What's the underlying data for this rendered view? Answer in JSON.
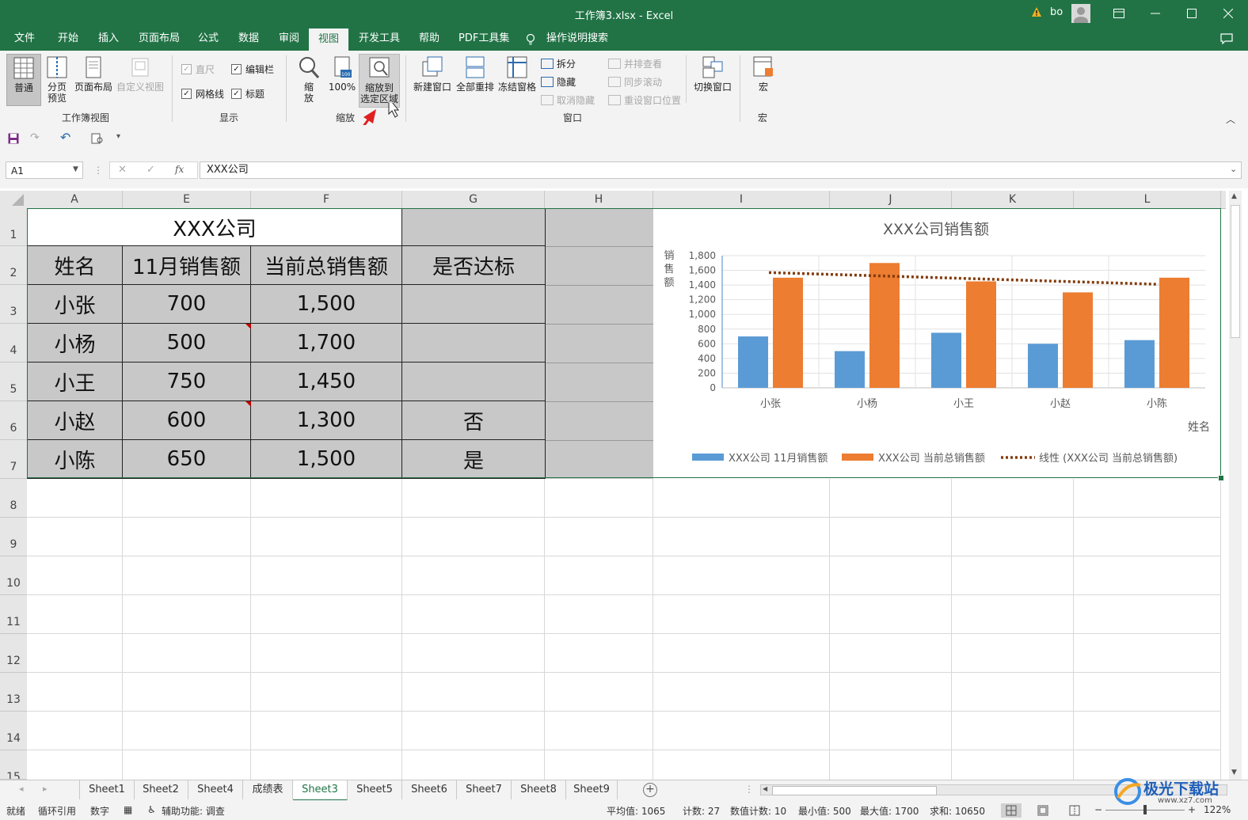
{
  "window": {
    "title": "工作簿3.xlsx  -  Excel",
    "user": "bo",
    "warning_icon": "warning-icon"
  },
  "menu": [
    "文件",
    "开始",
    "插入",
    "页面布局",
    "公式",
    "数据",
    "审阅",
    "视图",
    "开发工具",
    "帮助",
    "PDF工具集",
    "操作说明搜索"
  ],
  "menu_active": "视图",
  "ribbon": {
    "workbook_views": {
      "label": "工作簿视图",
      "normal": "普通",
      "page_break": "分页\n预览",
      "page_layout": "页面布局",
      "custom": "自定义视图"
    },
    "show": {
      "label": "显示",
      "ruler": "直尺",
      "formula_bar": "编辑栏",
      "gridlines": "网格线",
      "headings": "标题"
    },
    "zoom": {
      "label": "缩放",
      "zoom": "缩\n放",
      "zoom100": "100%",
      "zoom_selection": "缩放到\n选定区域"
    },
    "window": {
      "label": "窗口",
      "new_window": "新建窗口",
      "arrange_all": "全部重排",
      "freeze_panes": "冻结窗格",
      "split": "拆分",
      "hide": "隐藏",
      "unhide": "取消隐藏",
      "side_by_side": "并排查看",
      "sync_scroll": "同步滚动",
      "reset_position": "重设窗口位置",
      "switch_windows": "切换窗口"
    },
    "macros": {
      "label": "宏",
      "macros": "宏"
    }
  },
  "formula_bar": {
    "name_box": "A1",
    "content": "XXX公司",
    "fx": "fx"
  },
  "columns": [
    "A",
    "E",
    "F",
    "G",
    "H",
    "I",
    "J",
    "K",
    "L"
  ],
  "rows": [
    "1",
    "2",
    "3",
    "4",
    "5",
    "6",
    "7",
    "8",
    "9",
    "10",
    "11",
    "12",
    "13",
    "14",
    "15"
  ],
  "table": {
    "title": "XXX公司",
    "headers": [
      "姓名",
      "11月销售额",
      "当前总销售额",
      "是否达标"
    ],
    "rows": [
      [
        "小张",
        "700",
        "1,500",
        ""
      ],
      [
        "小杨",
        "500",
        "1,700",
        ""
      ],
      [
        "小王",
        "750",
        "1,450",
        ""
      ],
      [
        "小赵",
        "600",
        "1,300",
        "否"
      ],
      [
        "小陈",
        "650",
        "1,500",
        "是"
      ]
    ]
  },
  "chart_data": {
    "type": "bar",
    "title": "XXX公司销售额",
    "xlabel": "姓名",
    "ylabel": "销售额",
    "categories": [
      "小张",
      "小杨",
      "小王",
      "小赵",
      "小陈"
    ],
    "ylim": [
      0,
      1800
    ],
    "yticks": [
      "0",
      "200",
      "400",
      "600",
      "800",
      "1,000",
      "1,200",
      "1,400",
      "1,600",
      "1,800"
    ],
    "series": [
      {
        "name": "XXX公司 11月销售额",
        "values": [
          700,
          500,
          750,
          600,
          650
        ],
        "color": "#5b9bd5"
      },
      {
        "name": "XXX公司 当前总销售额",
        "values": [
          1500,
          1700,
          1450,
          1300,
          1500
        ],
        "color": "#ed7d31"
      }
    ],
    "trendline": {
      "name": "线性 (XXX公司 当前总销售额)",
      "color": "#843c0c",
      "values": [
        1570,
        1530,
        1490,
        1450,
        1410
      ]
    },
    "legend": "bottom",
    "grid": true
  },
  "sheets": [
    "Sheet1",
    "Sheet2",
    "Sheet4",
    "成绩表",
    "Sheet3",
    "Sheet5",
    "Sheet6",
    "Sheet7",
    "Sheet8",
    "Sheet9"
  ],
  "active_sheet": "Sheet3",
  "status": {
    "ready": "就绪",
    "circular": "循环引用",
    "numeric": "数字",
    "accessibility": "辅助功能: 调查",
    "average": "平均值: 1065",
    "count": "计数: 27",
    "num_count": "数值计数: 10",
    "min": "最小值: 500",
    "max": "最大值: 1700",
    "sum": "求和: 10650",
    "zoom": "122%"
  },
  "watermark": "极光下载站\nwww.xz7.com"
}
